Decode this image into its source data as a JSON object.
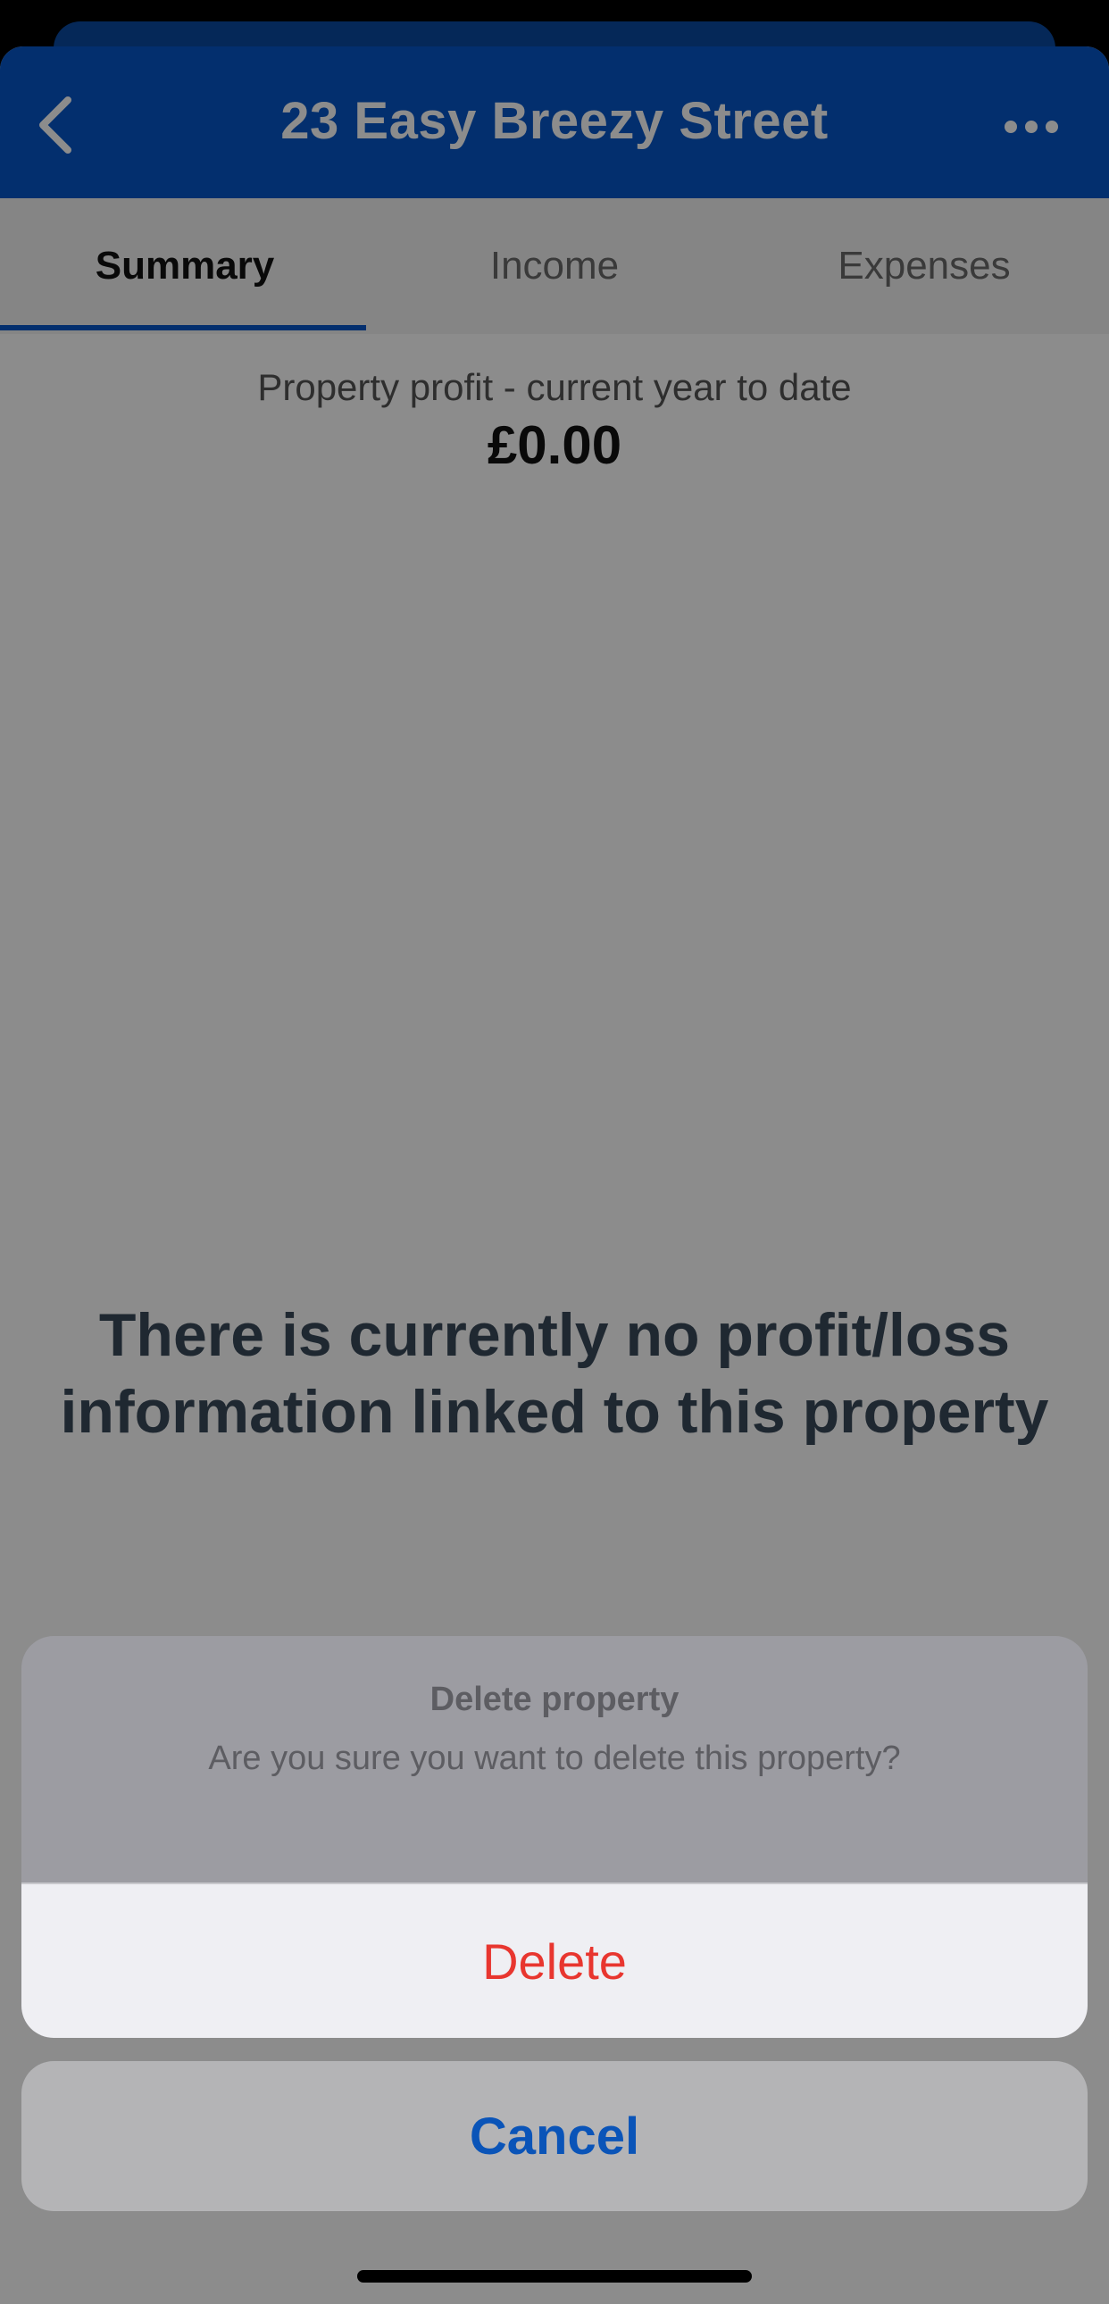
{
  "header": {
    "title": "23 Easy Breezy Street",
    "back_icon": "chevron-left-icon",
    "more_icon": "more-horizontal-icon"
  },
  "tabs": [
    {
      "label": "Summary",
      "active": true
    },
    {
      "label": "Income",
      "active": false
    },
    {
      "label": "Expenses",
      "active": false
    }
  ],
  "summary": {
    "profit_label": "Property profit - current year to date",
    "profit_value": "£0.00",
    "empty_message": "There is currently no profit/loss information linked to this property"
  },
  "action_sheet": {
    "title": "Delete property",
    "message": "Are you sure you want to delete this property?",
    "delete_label": "Delete",
    "cancel_label": "Cancel"
  },
  "colors": {
    "brand_blue": "#0656c8",
    "destructive_red": "#e8362f",
    "cancel_blue": "#0a54b8"
  }
}
